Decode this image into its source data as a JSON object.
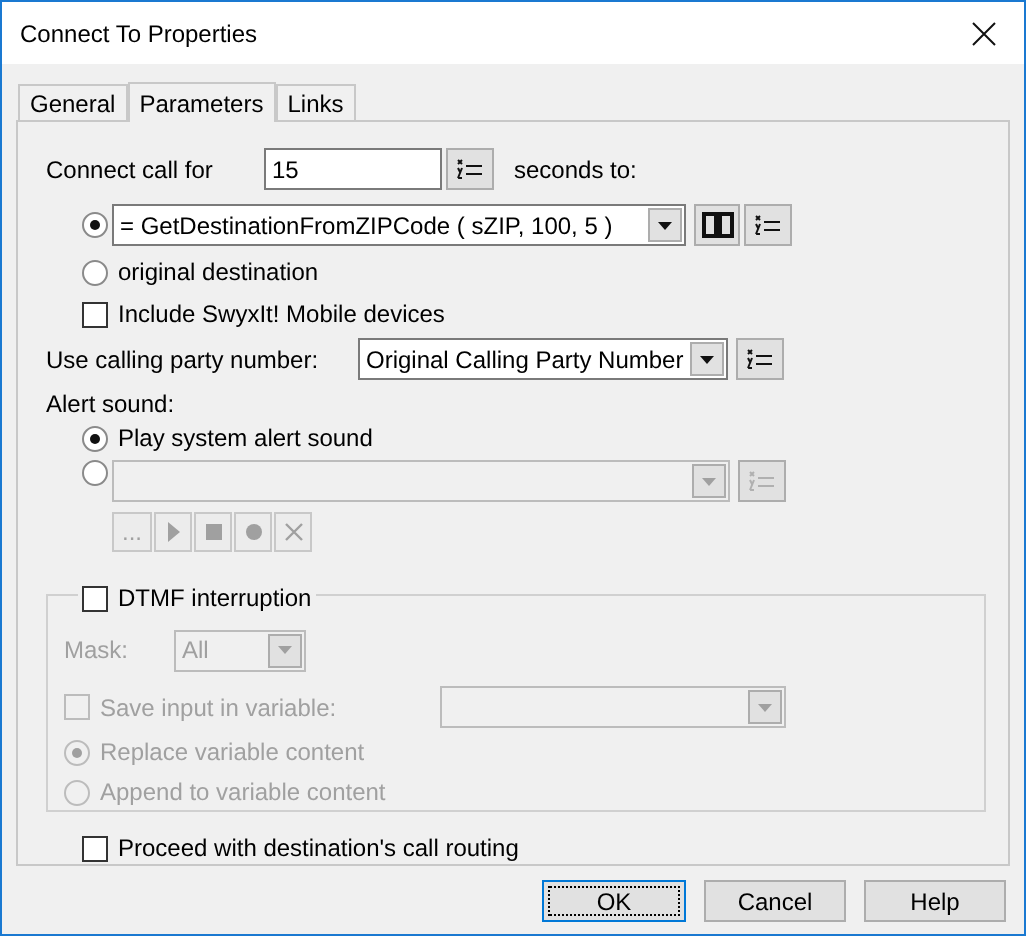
{
  "window": {
    "title": "Connect To Properties"
  },
  "tabs": [
    {
      "label": "General",
      "selected": false
    },
    {
      "label": "Parameters",
      "selected": true
    },
    {
      "label": "Links",
      "selected": false
    }
  ],
  "connect_call": {
    "label": "Connect call for",
    "value": "15",
    "suffix": "seconds to:"
  },
  "destination_options": [
    {
      "kind": "combo",
      "selected": true,
      "value": "= GetDestinationFromZIPCode ( sZIP, 100, 5 )"
    },
    {
      "kind": "text",
      "selected": false,
      "label": "original destination"
    }
  ],
  "include_mobile": {
    "label": "Include SwyxIt! Mobile devices",
    "checked": false
  },
  "calling_party": {
    "label": "Use calling party number:",
    "value": "Original Calling Party Number"
  },
  "alert_sound": {
    "label": "Alert sound:",
    "options": [
      {
        "kind": "text",
        "selected": true,
        "label": "Play system alert sound"
      },
      {
        "kind": "file",
        "selected": false,
        "browse": "..."
      }
    ]
  },
  "dtmf": {
    "label": "DTMF interruption",
    "checked": false,
    "mask": {
      "label": "Mask:",
      "value": "All"
    },
    "save_input": {
      "label": "Save input in variable:",
      "checked": false
    },
    "content_options": [
      {
        "label": "Replace variable content",
        "selected": true
      },
      {
        "label": "Append to variable content",
        "selected": false
      }
    ]
  },
  "proceed": {
    "label": "Proceed with destination's call routing",
    "checked": false
  },
  "buttons": [
    {
      "label": "OK",
      "default": true
    },
    {
      "label": "Cancel",
      "default": false
    },
    {
      "label": "Help",
      "default": false
    }
  ]
}
